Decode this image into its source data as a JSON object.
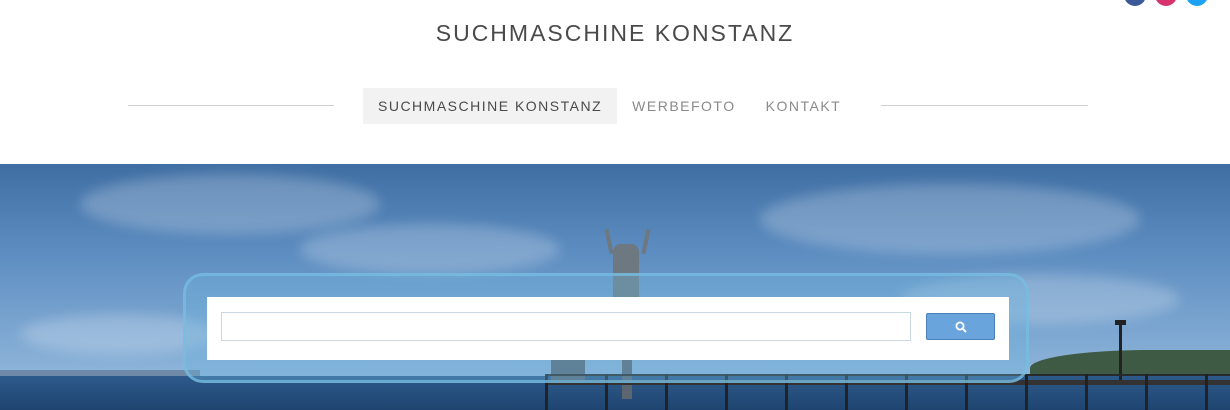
{
  "header": {
    "site_title": "SUCHMASCHINE KONSTANZ",
    "social": [
      "facebook-icon",
      "instagram-icon",
      "twitter-icon"
    ]
  },
  "nav": {
    "items": [
      {
        "label": "SUCHMASCHINE KONSTANZ",
        "active": true
      },
      {
        "label": "WERBEFOTO",
        "active": false
      },
      {
        "label": "KONTAKT",
        "active": false
      }
    ]
  },
  "search": {
    "value": "",
    "placeholder": "",
    "button_icon": "search-icon"
  },
  "colors": {
    "title": "#4a4a4a",
    "nav_inactive": "#8a8a8a",
    "nav_active_bg": "#f2f2f2",
    "search_button": "#6aa4dc",
    "facebook": "#3b5998",
    "instagram": "#d6336c",
    "twitter": "#1da1f2"
  }
}
